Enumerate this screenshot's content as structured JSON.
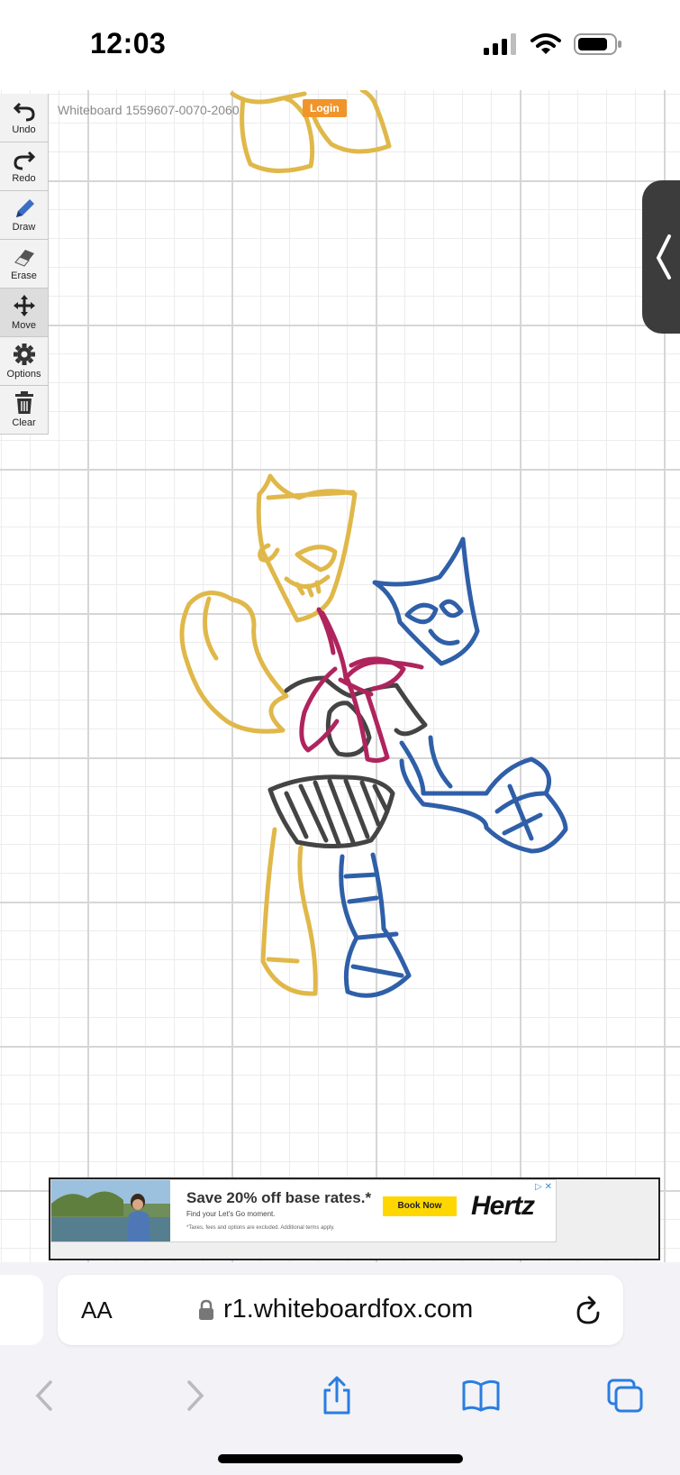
{
  "status_bar": {
    "time": "12:03",
    "icons": [
      "cellular-signal-icon",
      "wifi-icon",
      "battery-icon"
    ]
  },
  "whiteboard": {
    "title": "Whiteboard 1559607-0070-2060",
    "login_label": "Login",
    "colors": {
      "yellow": "#e0b84a",
      "blue": "#2f5fa8",
      "magenta": "#b0245e",
      "dark": "#444444",
      "login_orange": "#f0952a"
    }
  },
  "toolbar": {
    "tools": [
      {
        "label": "Undo",
        "icon": "undo-icon"
      },
      {
        "label": "Redo",
        "icon": "redo-icon"
      },
      {
        "label": "Draw",
        "icon": "pencil-icon"
      },
      {
        "label": "Erase",
        "icon": "eraser-icon"
      },
      {
        "label": "Move",
        "icon": "move-icon"
      },
      {
        "label": "Options",
        "icon": "gear-icon"
      },
      {
        "label": "Clear",
        "icon": "trash-icon"
      }
    ]
  },
  "ad": {
    "headline": "Save 20% off base rates.*",
    "subline": "Find your Let's Go moment.",
    "fine_print": "*Taxes, fees and options are excluded. Additional terms apply.",
    "cta": "Book Now",
    "brand": "Hertz",
    "choices": "▷ ✕"
  },
  "browser": {
    "text_size_label": "AA",
    "url": "r1.whiteboardfox.com",
    "nav": [
      "back-icon",
      "forward-icon",
      "share-icon",
      "bookmarks-icon",
      "tabs-icon"
    ]
  }
}
